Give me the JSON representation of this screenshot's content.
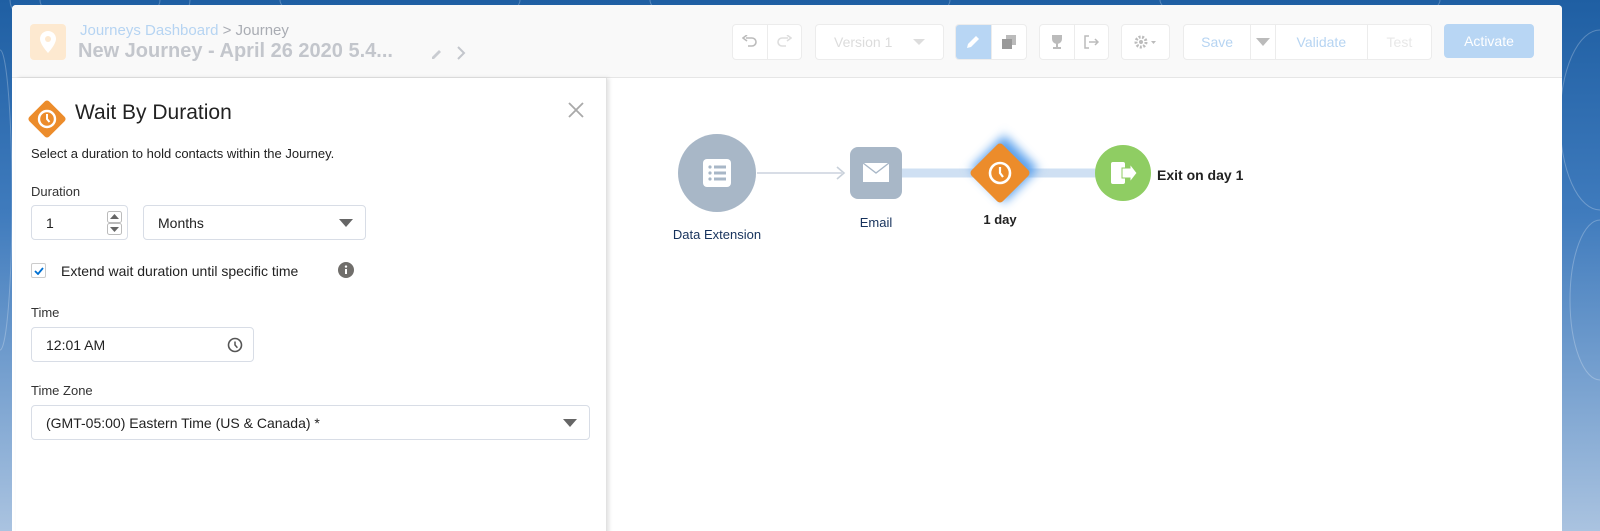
{
  "header": {
    "breadcrumb_link": "Journeys Dashboard",
    "breadcrumb_sep": ">",
    "breadcrumb_current": "Journey",
    "title": "New Journey - April 26 2020 5.4...",
    "version_label": "Version 1",
    "save_label": "Save",
    "validate_label": "Validate",
    "test_label": "Test",
    "activate_label": "Activate",
    "icons": [
      "map-pin-icon",
      "pencil-icon",
      "chevron-right-icon",
      "undo-icon",
      "redo-icon",
      "edit-mode-icon",
      "copy-icon",
      "trophy-icon",
      "exit-icon",
      "gear-icon"
    ]
  },
  "panel": {
    "title": "Wait By Duration",
    "description": "Select a duration to hold contacts within the Journey.",
    "duration_label": "Duration",
    "duration_value": "1",
    "duration_unit": "Months",
    "extend_checked": true,
    "extend_label": "Extend wait duration until specific time",
    "time_label": "Time",
    "time_value": "12:01 AM",
    "timezone_label": "Time Zone",
    "timezone_value": "(GMT-05:00) Eastern Time (US & Canada) *"
  },
  "canvas": {
    "nodes": [
      {
        "type": "entry",
        "label": "Data Extension"
      },
      {
        "type": "email",
        "label": "Email"
      },
      {
        "type": "wait",
        "label": "1 day"
      },
      {
        "type": "exit",
        "label": "Exit on day 1"
      }
    ]
  },
  "colors": {
    "accent": "#0070d2",
    "wait_orange": "#ec8c2b",
    "exit_green": "#8fcd63",
    "node_gray": "#a8b7c7",
    "activate_disabled": "#b8d6f4"
  }
}
